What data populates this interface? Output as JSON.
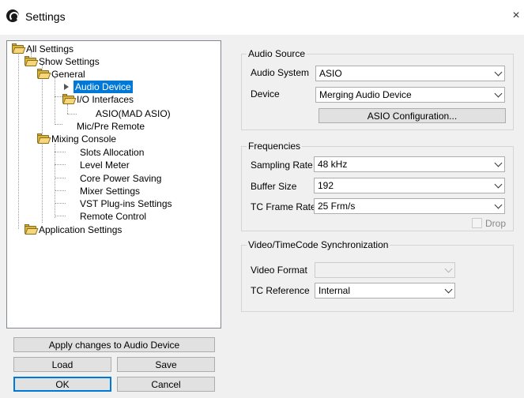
{
  "window": {
    "title": "Settings",
    "close_glyph": "×"
  },
  "tree": {
    "all_settings": "All Settings",
    "show_settings": "Show Settings",
    "general": "General",
    "audio_device": "Audio Device",
    "io_interfaces": "I/O Interfaces",
    "asio_mad": "ASIO(MAD ASIO)",
    "mic_pre_remote": "Mic/Pre Remote",
    "mixing_console": "Mixing Console",
    "slots_allocation": "Slots Allocation",
    "level_meter": "Level Meter",
    "core_power_saving": "Core Power Saving",
    "mixer_settings": "Mixer Settings",
    "vst_plugins_settings": "VST Plug-ins Settings",
    "remote_control": "Remote Control",
    "application_settings": "Application Settings"
  },
  "buttons": {
    "apply": "Apply changes to Audio Device",
    "load": "Load",
    "save": "Save",
    "ok": "OK",
    "cancel": "Cancel"
  },
  "audio_source": {
    "title": "Audio Source",
    "audio_system_label": "Audio System",
    "audio_system_value": "ASIO",
    "device_label": "Device",
    "device_value": "Merging Audio Device",
    "asio_config_button": "ASIO Configuration..."
  },
  "frequencies": {
    "title": "Frequencies",
    "sampling_rate_label": "Sampling Rate",
    "sampling_rate_value": "48 kHz",
    "buffer_size_label": "Buffer Size",
    "buffer_size_value": "192",
    "tc_frame_rate_label": "TC Frame Rate",
    "tc_frame_rate_value": "25 Frm/s",
    "drop_label": "Drop"
  },
  "video_sync": {
    "title": "Video/TimeCode Synchronization",
    "video_format_label": "Video Format",
    "video_format_value": "",
    "tc_reference_label": "TC Reference",
    "tc_reference_value": "Internal"
  }
}
